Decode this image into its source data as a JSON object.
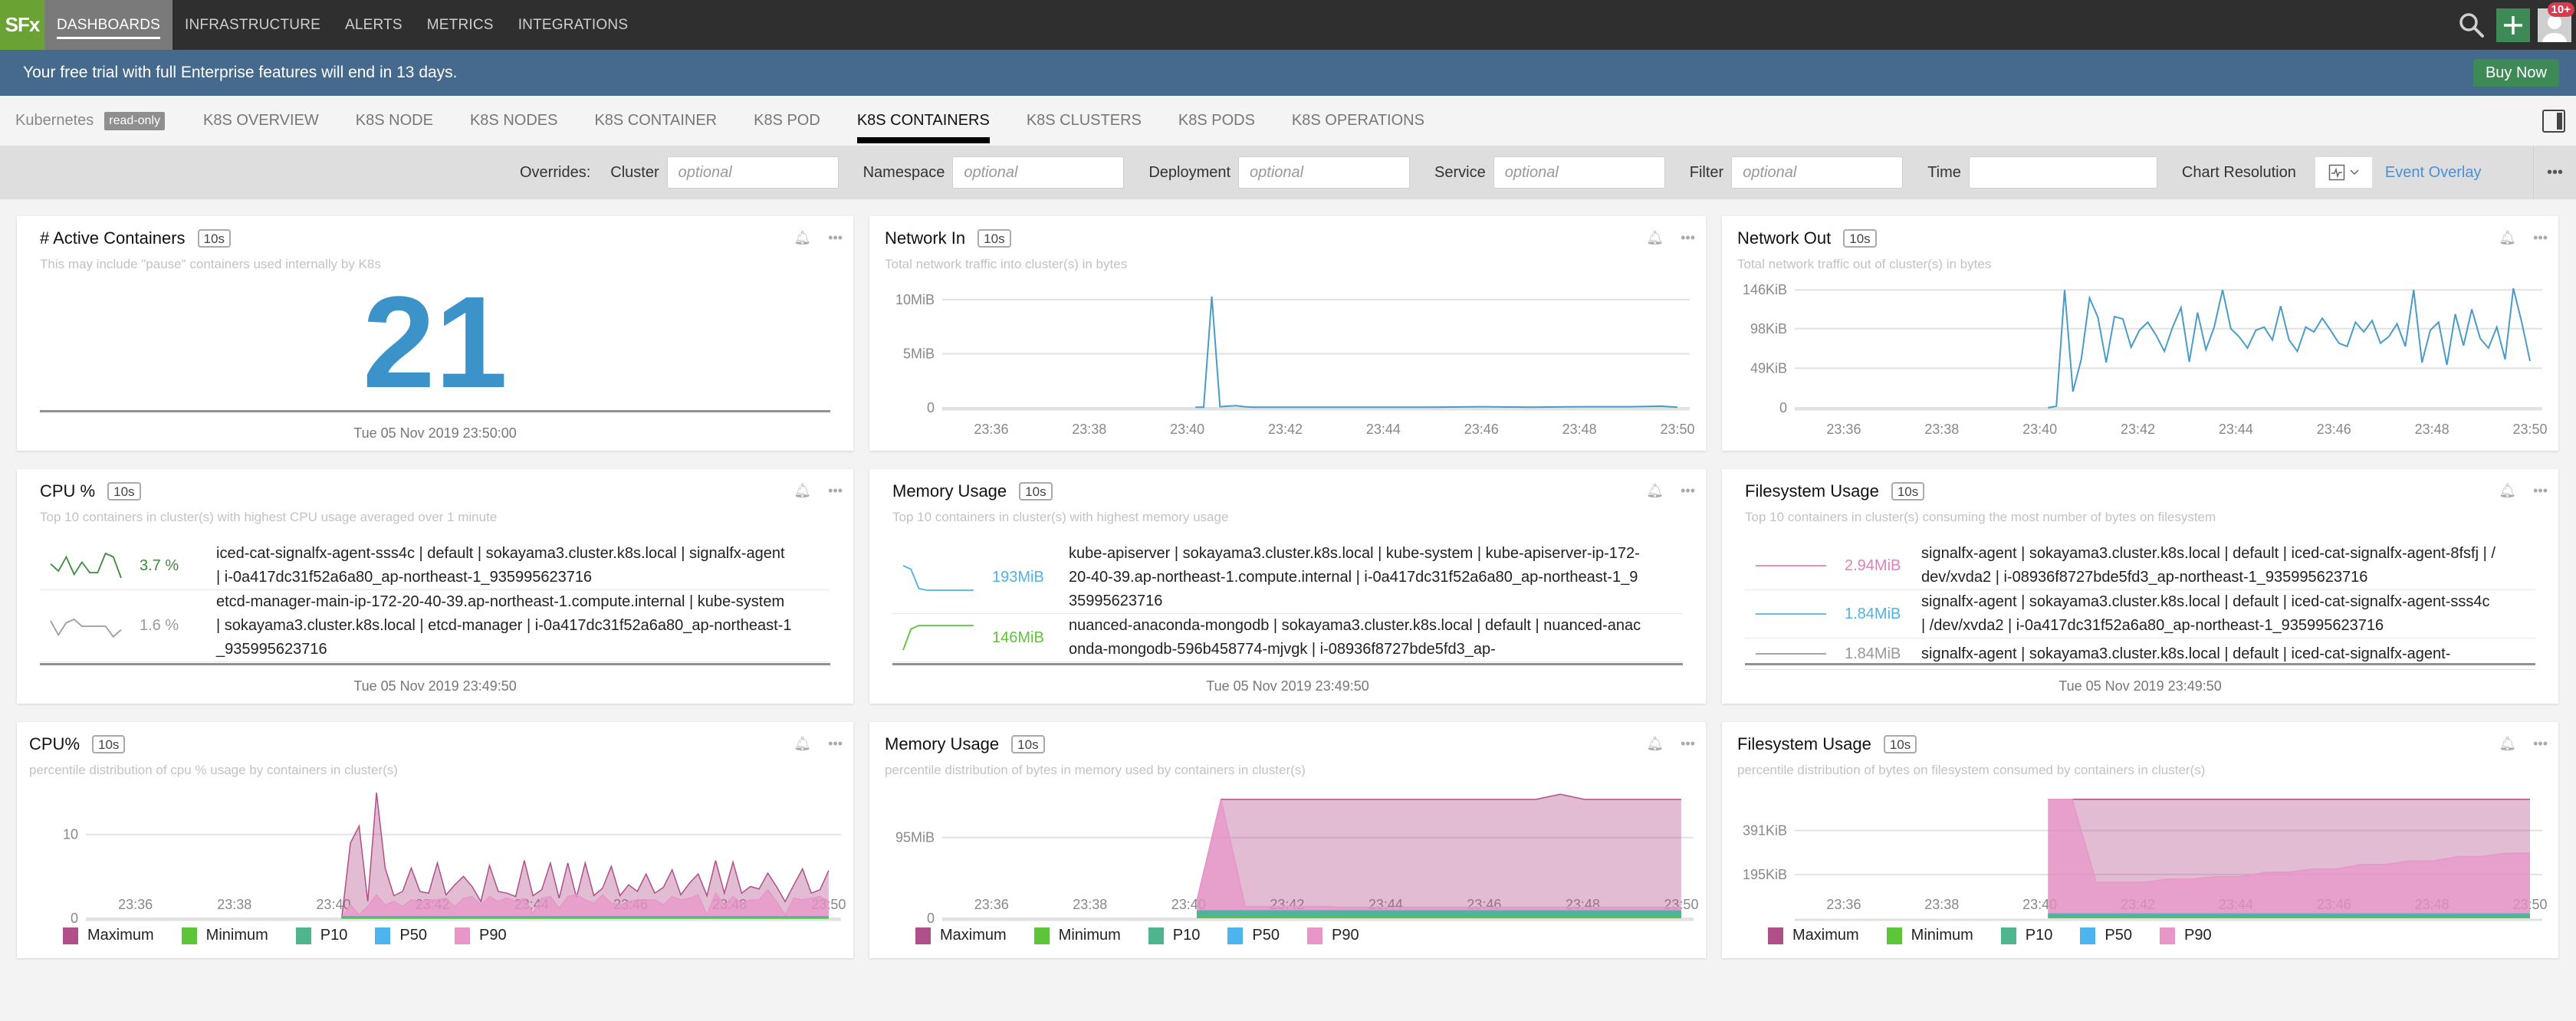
{
  "topnav": {
    "logo": "SFx",
    "items": [
      {
        "label": "DASHBOARDS",
        "active": true
      },
      {
        "label": "INFRASTRUCTURE"
      },
      {
        "label": "ALERTS"
      },
      {
        "label": "METRICS"
      },
      {
        "label": "INTEGRATIONS"
      }
    ],
    "notifications_badge": "10+",
    "icons": [
      "search-icon",
      "plus-icon",
      "avatar-icon"
    ]
  },
  "banner": {
    "text": "Your free trial with full Enterprise features will end in 13 days.",
    "buy_label": "Buy Now"
  },
  "tabs": {
    "group": "Kubernetes",
    "readonly_label": "read-only",
    "items": [
      "K8S OVERVIEW",
      "K8S NODE",
      "K8S NODES",
      "K8S CONTAINER",
      "K8S POD",
      "K8S CONTAINERS",
      "K8S CLUSTERS",
      "K8S PODS",
      "K8S OPERATIONS"
    ],
    "active": "K8S CONTAINERS"
  },
  "overrides": {
    "title": "Overrides:",
    "fields": [
      {
        "label": "Cluster",
        "placeholder": "optional",
        "value": ""
      },
      {
        "label": "Namespace",
        "placeholder": "optional",
        "value": ""
      },
      {
        "label": "Deployment",
        "placeholder": "optional",
        "value": ""
      },
      {
        "label": "Service",
        "placeholder": "optional",
        "value": ""
      },
      {
        "label": "Filter",
        "placeholder": "optional",
        "value": ""
      },
      {
        "label": "Time",
        "placeholder": "",
        "value": ""
      }
    ],
    "chart_resolution_label": "Chart Resolution",
    "event_overlay_label": "Event Overlay"
  },
  "colors": {
    "accent_blue": "#3b93c9",
    "line_blue": "#4a9cc7",
    "maximum": "#b04f8a",
    "minimum": "#5ec43a",
    "p10": "#4fb58e",
    "p50": "#4db4f0",
    "p90": "#e895c8"
  },
  "panels": {
    "active_containers": {
      "title": "# Active Containers",
      "resolution": "10s",
      "description": "This may include \"pause\" containers used internally by K8s",
      "value": "21",
      "timestamp": "Tue 05 Nov 2019 23:50:00"
    },
    "network_in": {
      "title": "Network In",
      "resolution": "10s",
      "description": "Total network traffic into cluster(s) in bytes"
    },
    "network_out": {
      "title": "Network Out",
      "resolution": "10s",
      "description": "Total network traffic out of cluster(s) in bytes"
    },
    "cpu_top": {
      "title": "CPU %",
      "resolution": "10s",
      "description": "Top 10 containers in cluster(s) with highest CPU usage averaged over 1 minute",
      "rows": [
        {
          "value": "3.7 %",
          "color": "#3d8a3a",
          "text": "iced-cat-signalfx-agent-sss4c | default | sokayama3.cluster.k8s.local | signalfx-agent | i-0a417dc31f52a6a80_ap-northeast-1_935995623716",
          "spark": [
            8,
            4,
            12,
            2,
            9,
            3,
            3,
            14,
            12,
            0
          ]
        },
        {
          "value": "1.6 %",
          "color": "#9a9aa8",
          "text": "etcd-manager-main-ip-172-20-40-39.ap-northeast-1.compute.internal | kube-system | sokayama3.cluster.k8s.local | etcd-manager | i-0a417dc31f52a6a80_ap-northeast-1_935995623716",
          "spark": [
            10,
            2,
            9,
            11,
            7,
            7,
            7,
            7,
            1,
            5
          ]
        }
      ],
      "timestamp": "Tue 05 Nov 2019 23:49:50"
    },
    "memory_top": {
      "title": "Memory Usage",
      "resolution": "10s",
      "description": "Top 10 containers in cluster(s) with highest memory usage",
      "rows": [
        {
          "value": "193MiB",
          "color": "#4db4e6",
          "text": "kube-apiserver | sokayama3.cluster.k8s.local | kube-system | kube-apiserver-ip-172-20-40-39.ap-northeast-1.compute.internal | i-0a417dc31f52a6a80_ap-northeast-1_935995623716",
          "spark": [
            14,
            12,
            1,
            0,
            0,
            0,
            0,
            0,
            0,
            0
          ]
        },
        {
          "value": "146MiB",
          "color": "#5ec43a",
          "text": "nuanced-anaconda-mongodb | sokayama3.cluster.k8s.local | default | nuanced-anaconda-mongodb-596b458774-mjvgk | i-08936f8727bde5fd3_ap-",
          "spark": [
            0,
            12,
            14,
            14,
            14,
            14,
            14,
            14,
            14,
            14
          ]
        }
      ],
      "timestamp": "Tue 05 Nov 2019 23:49:50"
    },
    "fs_top": {
      "title": "Filesystem Usage",
      "resolution": "10s",
      "description": "Top 10 containers in cluster(s) consuming the most number of bytes on filesystem",
      "rows": [
        {
          "value": "2.94MiB",
          "color": "#e07fbf",
          "text": "signalfx-agent | sokayama3.cluster.k8s.local | default | iced-cat-signalfx-agent-8fsfj | /dev/xvda2 | i-08936f8727bde5fd3_ap-northeast-1_935995623716",
          "spark": [
            7,
            7,
            7,
            7,
            7,
            7,
            7,
            7,
            7,
            7
          ]
        },
        {
          "value": "1.84MiB",
          "color": "#4db4e6",
          "text": "signalfx-agent | sokayama3.cluster.k8s.local | default | iced-cat-signalfx-agent-sss4c | /dev/xvda2 | i-0a417dc31f52a6a80_ap-northeast-1_935995623716",
          "spark": [
            7,
            7,
            7,
            7,
            7,
            7,
            7,
            7,
            7,
            7
          ]
        },
        {
          "value": "1.84MiB",
          "color": "#999999",
          "text": "signalfx-agent | sokayama3.cluster.k8s.local | default | iced-cat-signalfx-agent-",
          "spark": [
            7,
            7,
            7,
            7,
            7,
            7,
            7,
            7,
            7,
            7
          ]
        }
      ],
      "timestamp": "Tue 05 Nov 2019 23:49:50"
    },
    "cpu_dist": {
      "title": "CPU%",
      "resolution": "10s",
      "description": "percentile distribution of cpu % usage by containers in cluster(s)"
    },
    "memory_dist": {
      "title": "Memory Usage",
      "resolution": "10s",
      "description": "percentile distribution of bytes in memory used by containers in cluster(s)"
    },
    "fs_dist": {
      "title": "Filesystem Usage",
      "resolution": "10s",
      "description": "percentile distribution of bytes on filesystem consumed by containers in cluster(s)"
    }
  },
  "chart_data": [
    {
      "id": "network_in",
      "type": "line",
      "title": "Network In",
      "x": [
        "23:40:10",
        "23:40:20",
        "23:40:30",
        "23:40:40",
        "23:40:50",
        "23:41:00",
        "23:41:10",
        "23:41:20",
        "23:42",
        "23:43",
        "23:44",
        "23:45",
        "23:46",
        "23:47",
        "23:48",
        "23:49",
        "23:49:40",
        "23:50"
      ],
      "series": [
        {
          "name": "Network In",
          "values": [
            0.05,
            0.05,
            10.3,
            0.1,
            0.15,
            0.2,
            0.1,
            0.05,
            0.05,
            0.05,
            0.05,
            0.05,
            0.1,
            0.05,
            0.1,
            0.1,
            0.15,
            0.05
          ]
        }
      ],
      "xticks": [
        "23:36",
        "23:38",
        "23:40",
        "23:42",
        "23:44",
        "23:46",
        "23:48",
        "23:50"
      ],
      "yticks": [
        "0",
        "5MiB",
        "10MiB"
      ],
      "ylabel": "MiB",
      "xrange": [
        "23:35",
        "23:50"
      ],
      "ylim": [
        0,
        10.5
      ],
      "grid": true
    },
    {
      "id": "network_out",
      "type": "line",
      "title": "Network Out",
      "series": [
        {
          "name": "Network Out",
          "values": [
            0,
            2,
            146,
            20,
            60,
            136,
            112,
            56,
            113,
            110,
            75,
            96,
            106,
            90,
            70,
            100,
            124,
            57,
            118,
            72,
            100,
            146,
            98,
            88,
            74,
            96,
            100,
            84,
            126,
            84,
            70,
            100,
            94,
            111,
            96,
            80,
            76,
            106,
            94,
            108,
            80,
            88,
            104,
            76,
            146,
            56,
            96,
            106,
            53,
            116,
            77,
            122,
            86,
            74,
            100,
            60,
            148,
            106,
            58
          ]
        }
      ],
      "x_start": "23:40:10",
      "x_end": "23:50",
      "xticks": [
        "23:36",
        "23:38",
        "23:40",
        "23:42",
        "23:44",
        "23:46",
        "23:48",
        "23:50"
      ],
      "yticks": [
        "0",
        "49KiB",
        "98KiB",
        "146KiB"
      ],
      "ylabel": "KiB",
      "ylim": [
        0,
        150
      ],
      "grid": true
    },
    {
      "id": "cpu_dist",
      "type": "area",
      "title": "CPU%",
      "xticks": [
        "23:36",
        "23:38",
        "23:40",
        "23:42",
        "23:44",
        "23:46",
        "23:48",
        "23:50"
      ],
      "yticks": [
        "0",
        "10"
      ],
      "ylim": [
        0,
        15
      ],
      "legend": [
        "Maximum",
        "Minimum",
        "P10",
        "P50",
        "P90"
      ],
      "legend_position": "bottom-left",
      "series": [
        {
          "name": "Maximum",
          "values": [
            0,
            9,
            11,
            2,
            15,
            6,
            2.7,
            3.2,
            6,
            3.2,
            3,
            6.6,
            2.8,
            4,
            5,
            3.8,
            2,
            6.3,
            3.2,
            3,
            2.6,
            6.9,
            2.7,
            3.4,
            6.6,
            2.4,
            6.6,
            2.5,
            6.6,
            2.7,
            3.6,
            6.2,
            2.7,
            4,
            3.2,
            5.3,
            3,
            3.7,
            5.8,
            2.8,
            4.2,
            5.3,
            2.7,
            6.9,
            3,
            6.7,
            3,
            3.8,
            3.5,
            5.4,
            3.8,
            2,
            4,
            5.9,
            3,
            3.4,
            5.7
          ]
        },
        {
          "name": "P90",
          "values": [
            0,
            1.6,
            0.4,
            1.4,
            2.8,
            1.6,
            2,
            1.4,
            2.2,
            2,
            2.2,
            2.2,
            2.4,
            1.4,
            2.4,
            2.6,
            1.6,
            2.6,
            2,
            2.4,
            2,
            2.4,
            0.6,
            2.4,
            2.6,
            1.2,
            2.6,
            2.8,
            2.2,
            1.8,
            2.8,
            1.8,
            1.6,
            2,
            2.2,
            2.2,
            2.2,
            1.6,
            2.6,
            2.2,
            2.4,
            2.8,
            0.4,
            3,
            1.6,
            2.6,
            1.8,
            2.2,
            2.2,
            3.4,
            2,
            0.4,
            2.4,
            2.2,
            2.4,
            2.6,
            2
          ]
        },
        {
          "name": "P50",
          "values": [
            0.2,
            0.2,
            0.2,
            0.2,
            0.2,
            0.2,
            0.2,
            0.2,
            0.2,
            0.2
          ]
        },
        {
          "name": "P10",
          "values": [
            0.1,
            0.1,
            0.1,
            0.1,
            0.1,
            0.1,
            0.1,
            0.1,
            0.1,
            0.1
          ]
        },
        {
          "name": "Minimum",
          "values": [
            0,
            0,
            0,
            0,
            0,
            0,
            0,
            0,
            0,
            0
          ]
        }
      ],
      "x_start": "23:40:10",
      "x_end": "23:50",
      "grid": true
    },
    {
      "id": "memory_dist",
      "type": "area",
      "title": "Memory Usage",
      "xticks": [
        "23:36",
        "23:38",
        "23:40",
        "23:42",
        "23:44",
        "23:46",
        "23:48",
        "23:50"
      ],
      "yticks": [
        "0",
        "95MiB"
      ],
      "ylim": [
        0,
        148
      ],
      "legend": [
        "Maximum",
        "Minimum",
        "P10",
        "P50",
        "P90"
      ],
      "legend_position": "bottom-left",
      "series": [
        {
          "name": "Maximum",
          "values": [
            20,
            140,
            140,
            140,
            140,
            140,
            140,
            140,
            140,
            140,
            140,
            140,
            140,
            140,
            140,
            146,
            140,
            140,
            140,
            140,
            140
          ]
        },
        {
          "name": "P90",
          "values": [
            20,
            140,
            14,
            14,
            14,
            14,
            13,
            13,
            13,
            13,
            13,
            13,
            13,
            13,
            13,
            13,
            13,
            13,
            13,
            13,
            13
          ]
        },
        {
          "name": "P50",
          "values": [
            9,
            9,
            9,
            9,
            9,
            9,
            9,
            9,
            9,
            9,
            9,
            9,
            9,
            9,
            9,
            9,
            9,
            9,
            9,
            9,
            9
          ]
        },
        {
          "name": "P10",
          "values": [
            8,
            8,
            8,
            8,
            8,
            8,
            8,
            8,
            8,
            8,
            8,
            8,
            8,
            8,
            8,
            8,
            8,
            8,
            8,
            8,
            8
          ]
        },
        {
          "name": "Minimum",
          "values": [
            1,
            1,
            1,
            1,
            1,
            1,
            1,
            1,
            1,
            1,
            1,
            1,
            1,
            1,
            1,
            1,
            1,
            1,
            1,
            1,
            1
          ]
        }
      ],
      "x_start": "23:40:10",
      "x_end": "23:50",
      "grid": true
    },
    {
      "id": "fs_dist",
      "type": "area",
      "title": "Filesystem Usage",
      "xticks": [
        "23:36",
        "23:38",
        "23:40",
        "23:42",
        "23:44",
        "23:46",
        "23:48",
        "23:50"
      ],
      "yticks": [
        "195KiB",
        "391KiB"
      ],
      "ylim": [
        0,
        560
      ],
      "legend": [
        "Maximum",
        "Minimum",
        "P10",
        "P50",
        "P90"
      ],
      "legend_position": "bottom-left",
      "series": [
        {
          "name": "Maximum",
          "values": [
            530,
            530,
            530,
            530,
            530,
            530,
            530,
            530,
            530,
            530,
            530,
            530,
            530,
            530,
            530,
            530,
            530,
            530,
            530,
            530,
            530
          ]
        },
        {
          "name": "P90",
          "values": [
            530,
            530,
            160,
            160,
            160,
            175,
            175,
            185,
            185,
            205,
            205,
            220,
            220,
            240,
            240,
            255,
            255,
            275,
            275,
            290,
            290
          ]
        },
        {
          "name": "P50",
          "values": [
            20,
            20,
            20,
            20,
            20,
            20,
            20,
            20,
            20,
            20,
            20,
            20,
            20,
            20,
            20,
            20,
            20,
            20,
            20,
            20,
            20
          ]
        },
        {
          "name": "P10",
          "values": [
            16,
            16,
            16,
            16,
            16,
            16,
            16,
            16,
            16,
            16,
            16,
            16,
            16,
            16,
            16,
            16,
            16,
            16,
            16,
            16,
            16
          ]
        },
        {
          "name": "Minimum",
          "values": [
            2,
            2,
            2,
            2,
            2,
            2,
            2,
            2,
            2,
            2,
            2,
            2,
            2,
            2,
            2,
            2,
            2,
            2,
            2,
            2,
            2
          ]
        }
      ],
      "x_start": "23:40:10",
      "x_end": "23:50",
      "grid": true
    }
  ]
}
